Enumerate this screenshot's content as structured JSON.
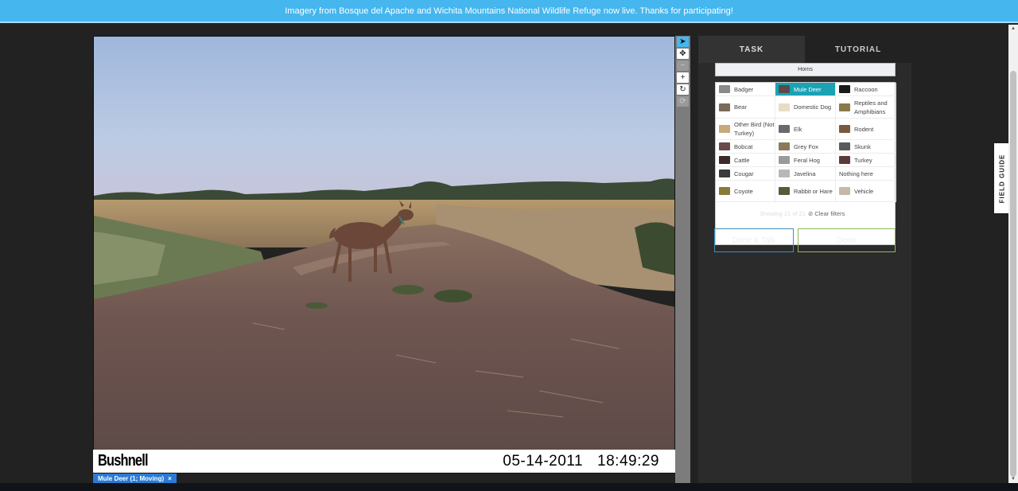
{
  "banner": {
    "text": "Imagery from Bosque del Apache and Wichita Mountains National Wildlife Refuge now live. Thanks for participating!"
  },
  "subject": {
    "camera_brand": "Bushnell",
    "date": "05-14-2011",
    "time": "18:49:29",
    "annotation_label": "Mule Deer (1; Moving)",
    "annotation_close": "×"
  },
  "tools": [
    {
      "name": "pointer-icon",
      "glyph": "➤"
    },
    {
      "name": "move-icon",
      "glyph": "✥"
    },
    {
      "name": "zoom-out-icon",
      "glyph": "−"
    },
    {
      "name": "zoom-in-icon",
      "glyph": "+"
    },
    {
      "name": "rotate-icon",
      "glyph": "↻"
    },
    {
      "name": "reset-icon",
      "glyph": "⟳"
    }
  ],
  "tabs": {
    "task": "TASK",
    "tutorial": "TUTORIAL"
  },
  "question": {
    "label": "Horns"
  },
  "choices": [
    {
      "label": "Badger",
      "thumb": "#8a8a8a"
    },
    {
      "label": "Mule Deer",
      "thumb": "#5a4a4a"
    },
    {
      "label": "Raccoon",
      "thumb": "#1a1a1a"
    },
    {
      "label": "Bear",
      "thumb": "#7a6a5a"
    },
    {
      "label": "Domestic Dog",
      "thumb": "#e8dcc8"
    },
    {
      "label": "Reptiles and Amphibians",
      "thumb": "#8a7a4a"
    },
    {
      "label": "Other Bird (Not Turkey)",
      "thumb": "#c9a87a"
    },
    {
      "label": "Elk",
      "thumb": "#6a6a6a"
    },
    {
      "label": "Rodent",
      "thumb": "#7a5a3a"
    },
    {
      "label": "Bobcat",
      "thumb": "#6a4a4a"
    },
    {
      "label": "Grey Fox",
      "thumb": "#8a7a5a"
    },
    {
      "label": "Skunk",
      "thumb": "#5a5a5a"
    },
    {
      "label": "Cattle",
      "thumb": "#3a2a2a"
    },
    {
      "label": "Feral Hog",
      "thumb": "#9a9a9a"
    },
    {
      "label": "Turkey",
      "thumb": "#5a3a3a"
    },
    {
      "label": "Cougar",
      "thumb": "#3a3a3a"
    },
    {
      "label": "Javelina",
      "thumb": "#b8b8b8"
    },
    {
      "label": "Nothing here",
      "thumb": ""
    },
    {
      "label": "Coyote",
      "thumb": "#8a7a3a"
    },
    {
      "label": "Rabbit or Hare",
      "thumb": "#5a5a3a"
    },
    {
      "label": "Vehicle",
      "thumb": "#c8b8a8"
    }
  ],
  "selected_choice": "Mule Deer",
  "filter": {
    "showing": "Showing 21 of 21",
    "clear": "⊘ Clear filters"
  },
  "buttons": {
    "done_talk": "Done & Talk",
    "done": "Done"
  },
  "field_guide": {
    "label": "FIELD GUIDE"
  },
  "colors": {
    "banner": "#45b6ee",
    "selected": "#1ba3b4",
    "done_talk_border": "#3f8fbf",
    "done_border": "#8fb85a"
  }
}
